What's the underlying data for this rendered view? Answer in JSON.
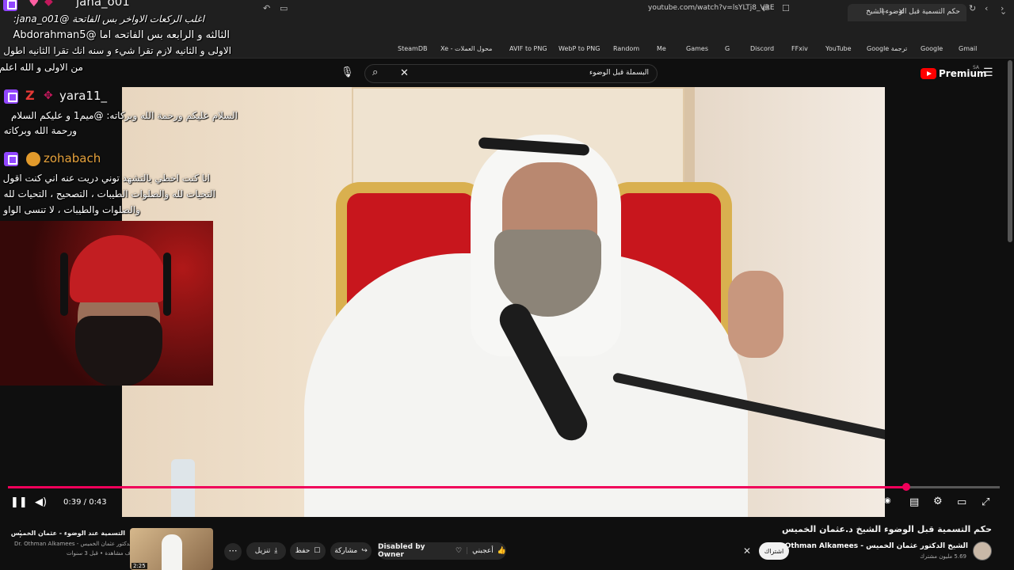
{
  "browser": {
    "tab_title": "حكم التسمية قبل الوضوء الشيخ",
    "url": "youtube.com/watch?v=lsYLTj8_VRE",
    "bookmarks": [
      "SteamDB",
      "Xe - محول العملات",
      "AVIF to PNG",
      "WebP to PNG",
      "Random",
      "Me",
      "Games",
      "G",
      "Discord",
      "FFxiv",
      "YouTube",
      "Google ترجمة",
      "Google",
      "Gmail"
    ]
  },
  "youtube": {
    "search_value": "البسملة قبل الوضوء",
    "logo_text": "Premium",
    "region": "SA"
  },
  "chat": {
    "messages": [
      {
        "user": "jana_o01",
        "text": "اغلب الركعات الاواخر بس الفاتحة @jana_o01:"
      },
      {
        "user": "",
        "text": "الثالثه و الرابعه بس الفاتحه اما @Abdorahman5"
      },
      {
        "user": "",
        "text": "الاولى و الثانيه لازم تقرا شيء و سنه انك تقرا الثانيه اطول"
      },
      {
        "user": "",
        "text": "من الاولى و الله اعلم"
      },
      {
        "user": "yara11_",
        "text": "السلام عليكم ورحمة الله وبركاته: @ميم1 و عليكم السلام"
      },
      {
        "user": "",
        "text": "ورحمة الله وبركاته"
      },
      {
        "user": "zohabach",
        "text": "انا كنت اخطي بالتشهد توني دريت عنه اني كنت اقول"
      },
      {
        "user": "",
        "text": "التحيات لله والصلوات الطيبات ، التصحيح ، التحيات لله"
      },
      {
        "user": "",
        "text": "والصلوات والطيبات ، لا تنسى الواو"
      }
    ]
  },
  "player": {
    "time_current": "0:39",
    "time_total": "0:43",
    "progress": 0.906
  },
  "video": {
    "title": "حكم التسمية قبل الوضوء الشيخ د.عثمان الخميس",
    "channel": "الشيخ الدكتور عثمان الخميس - Dr. Othman Alkamees",
    "subscribers": "5.69 مليون مشترك",
    "subscribe_label": "اشتراك",
    "like_label": "أعجبني",
    "dislike_label": "Disabled by Owner",
    "share_label": "مشاركة",
    "save_label": "حفظ",
    "download_label": "تنزيل"
  },
  "related": {
    "title": "التسمية عند الوضوء - عثمان الخميس",
    "channel": "Dr. Othman Alkamees - الدكتور عثمان الخميس",
    "meta": "4 آلاف مشاهدة • قبل 3 سنوات",
    "duration": "2:25"
  }
}
